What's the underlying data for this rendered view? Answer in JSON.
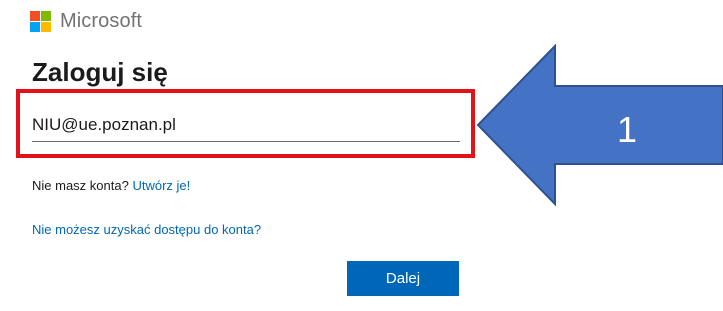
{
  "brand": {
    "name": "Microsoft",
    "logo_colors": [
      "#f25022",
      "#7fba00",
      "#00a4ef",
      "#ffb900"
    ]
  },
  "signin": {
    "title": "Zaloguj się",
    "email_value": "NIU@ue.poznan.pl",
    "no_account_text": "Nie masz konta?",
    "create_link": "Utwórz je!",
    "cant_access_link": "Nie możesz uzyskać dostępu do konta?",
    "next_button": "Dalej"
  },
  "annotation": {
    "arrow_label": "1",
    "arrow_color": "#4472c4",
    "highlight_color": "#e3111a"
  }
}
